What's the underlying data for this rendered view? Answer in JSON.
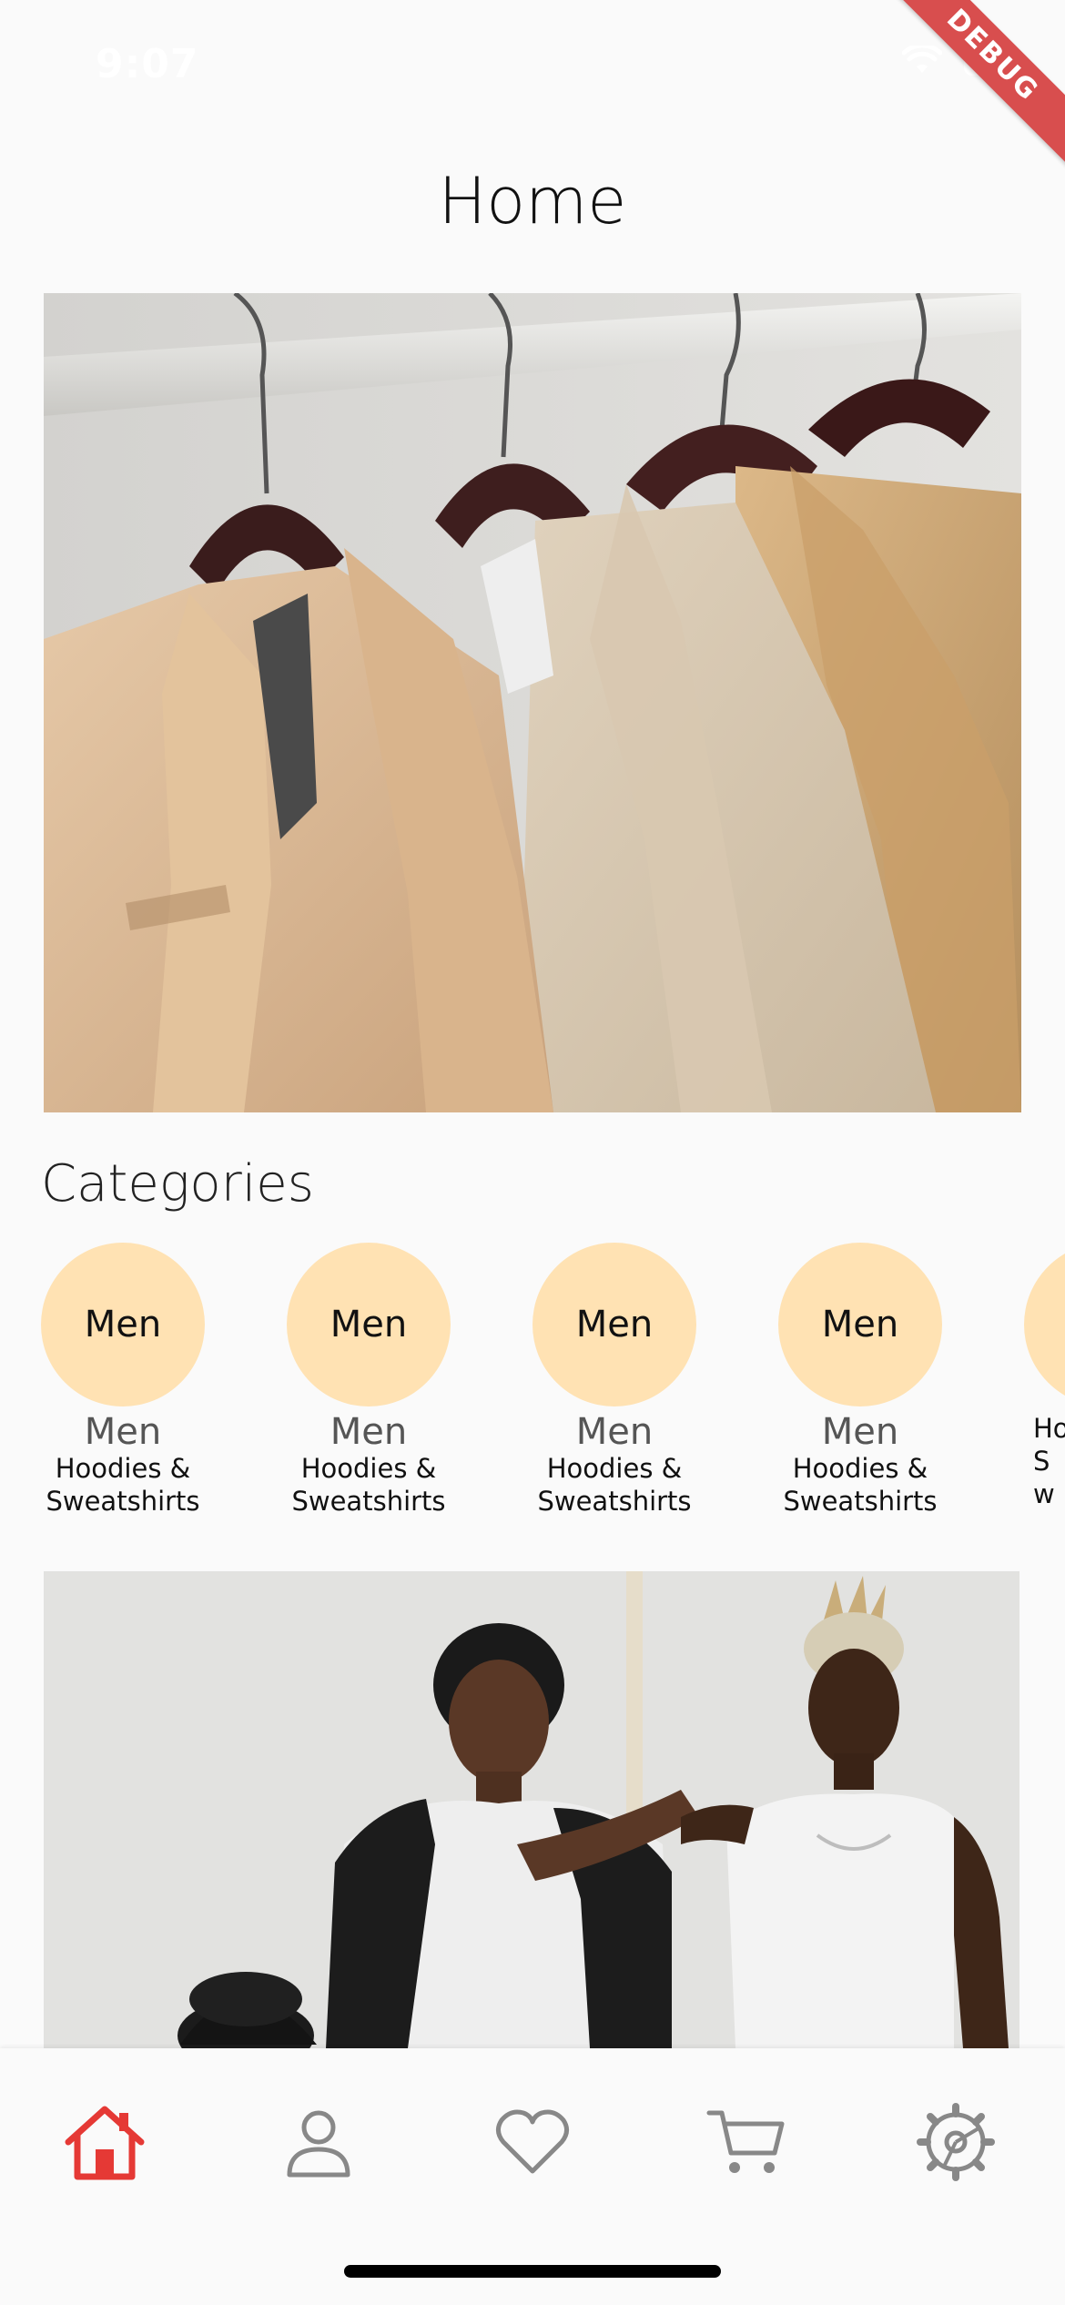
{
  "status_bar": {
    "time": "9:07",
    "debug_label": "DEBUG"
  },
  "header": {
    "title": "Home"
  },
  "hero": {
    "image": "coats-on-hangers"
  },
  "categories": {
    "title": "Categories",
    "items": [
      {
        "circle_label": "Men",
        "label": "Men",
        "sub": "Hoodies & Sweatshirts"
      },
      {
        "circle_label": "Men",
        "label": "Men",
        "sub": "Hoodies & Sweatshirts"
      },
      {
        "circle_label": "Men",
        "label": "Men",
        "sub": "Hoodies & Sweatshirts"
      },
      {
        "circle_label": "Men",
        "label": "Men",
        "sub": "Hoodies & Sweatshirts"
      },
      {
        "circle_label": "",
        "label": "",
        "sub": "Ho Sw"
      }
    ],
    "circle_color": "#ffe2b3"
  },
  "models_banner": {
    "image": "three-models-photo"
  },
  "bottom_nav": {
    "active_color": "#e53935",
    "inactive_color": "#888888",
    "items": [
      {
        "icon": "home-icon",
        "active": true
      },
      {
        "icon": "person-icon",
        "active": false
      },
      {
        "icon": "heart-icon",
        "active": false
      },
      {
        "icon": "cart-icon",
        "active": false
      },
      {
        "icon": "settings-icon",
        "active": false
      }
    ]
  }
}
